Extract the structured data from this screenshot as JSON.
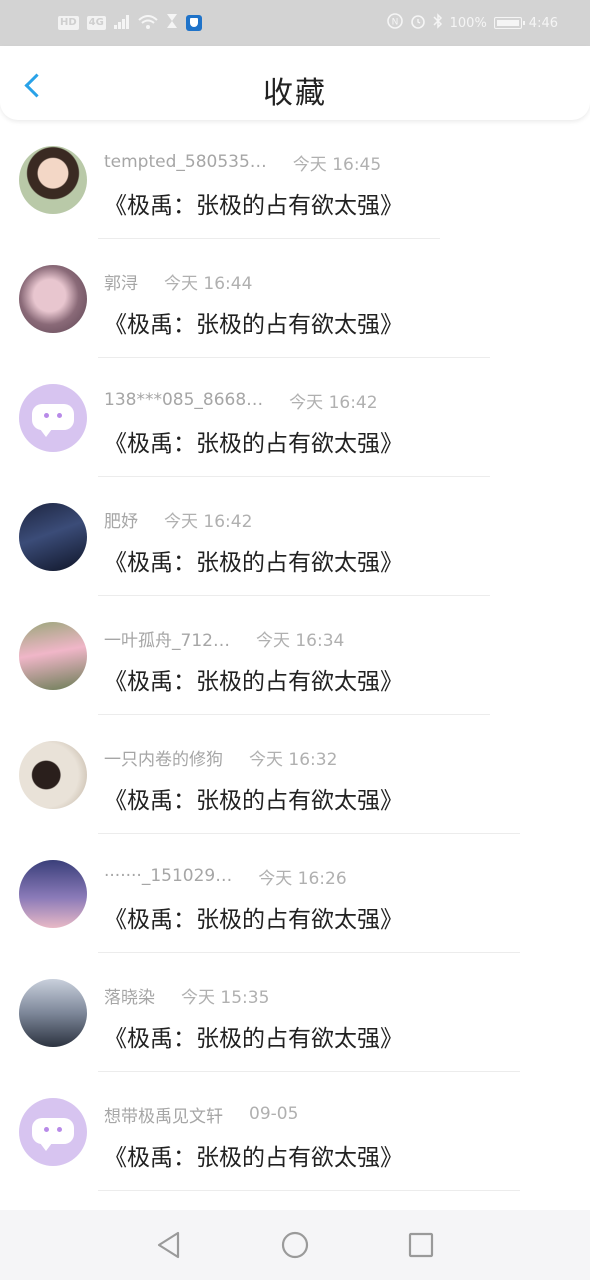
{
  "status_bar": {
    "left_chips": [
      "HD",
      "4G"
    ],
    "battery_text": "100%",
    "time": "4:46"
  },
  "header": {
    "title": "收藏"
  },
  "items": [
    {
      "name": "tempted_580535…",
      "time": "今天 16:45",
      "message": "《极禹：张极的占有欲太强》",
      "avatar": "photo"
    },
    {
      "name": "郭浔",
      "time": "今天 16:44",
      "message": "《极禹：张极的占有欲太强》",
      "avatar": "photo"
    },
    {
      "name": "138***085_8668…",
      "time": "今天 16:42",
      "message": "《极禹：张极的占有欲太强》",
      "avatar": "default"
    },
    {
      "name": "肥妤",
      "time": "今天 16:42",
      "message": "《极禹：张极的占有欲太强》",
      "avatar": "photo"
    },
    {
      "name": "一叶孤舟_712…",
      "time": "今天 16:34",
      "message": "《极禹：张极的占有欲太强》",
      "avatar": "photo"
    },
    {
      "name": "一只内卷的修狗",
      "time": "今天 16:32",
      "message": "《极禹：张极的占有欲太强》",
      "avatar": "photo"
    },
    {
      "name": "·······_151029…",
      "time": "今天 16:26",
      "message": "《极禹：张极的占有欲太强》",
      "avatar": "photo"
    },
    {
      "name": "落晓染",
      "time": "今天 15:35",
      "message": "《极禹：张极的占有欲太强》",
      "avatar": "photo"
    },
    {
      "name": "想带极禹见文轩",
      "time": "09-05",
      "message": "《极禹：张极的占有欲太强》",
      "avatar": "default"
    }
  ],
  "colors": {
    "accent": "#29a2e8",
    "default_avatar": "#d7c4f0",
    "status_bar": "#d3d3d3"
  }
}
